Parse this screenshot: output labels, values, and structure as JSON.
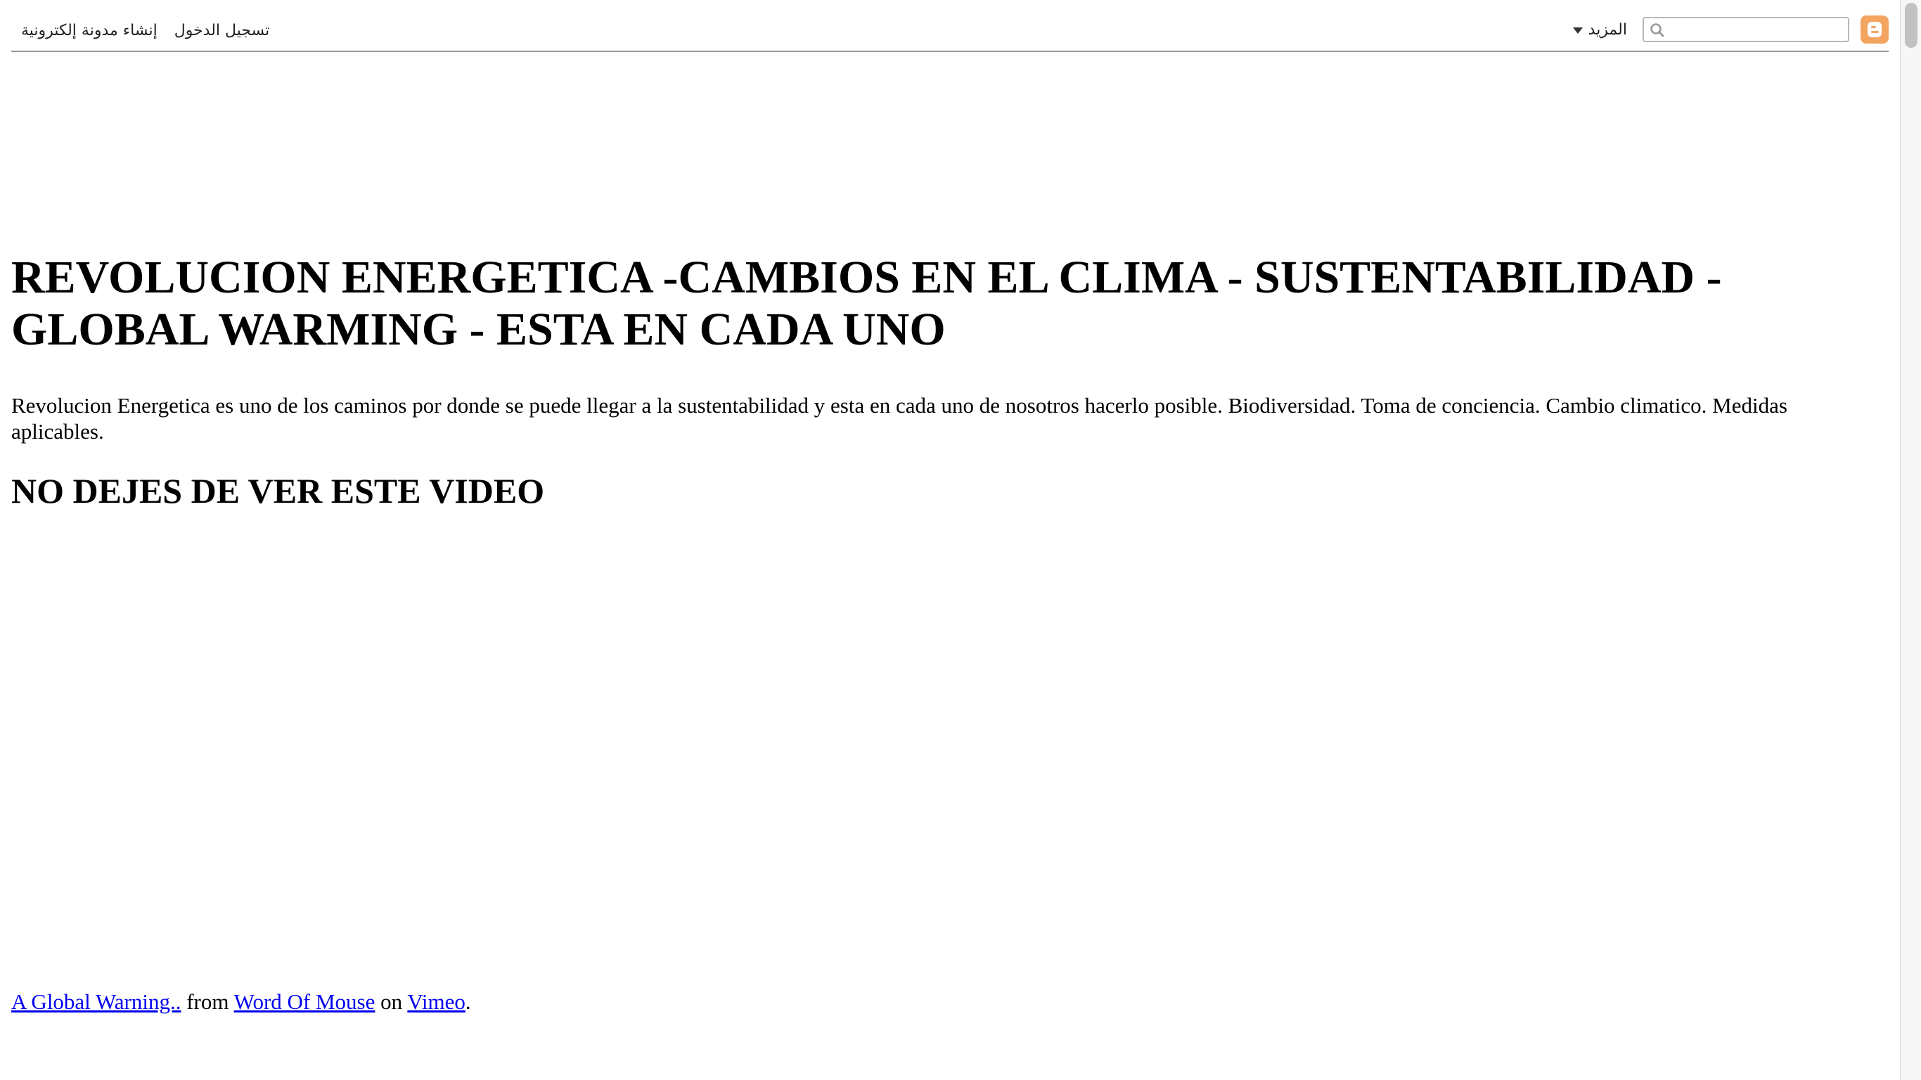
{
  "navbar": {
    "sign_in": "تسجيل الدخول",
    "create_blog": "إنشاء مدونة إلكترونية",
    "more": "المزيد",
    "search_value": "",
    "logo_icon": "blogger-icon",
    "logo_color": "#f4a461"
  },
  "header": {
    "title": "REVOLUCION ENERGETICA -CAMBIOS EN EL CLIMA - SUSTENTABILIDAD - GLOBAL WARMING - ESTA EN CADA UNO",
    "description": "Revolucion Energetica es uno de los caminos por donde se puede llegar a la sustentabilidad y esta en cada uno de nosotros hacerlo posible. Biodiversidad. Toma de conciencia. Cambio climatico. Medidas aplicables."
  },
  "post": {
    "title": "NO DEJES DE VER ESTE VIDEO",
    "credit": {
      "video_link": "A Global Warning..",
      "from_text": " from ",
      "author_link": "Word Of Mouse",
      "on_text": " on ",
      "site_link": "Vimeo",
      "end_text": "."
    }
  },
  "colors": {
    "link": "#0000ee",
    "navbar_border": "#9a9a9a"
  }
}
